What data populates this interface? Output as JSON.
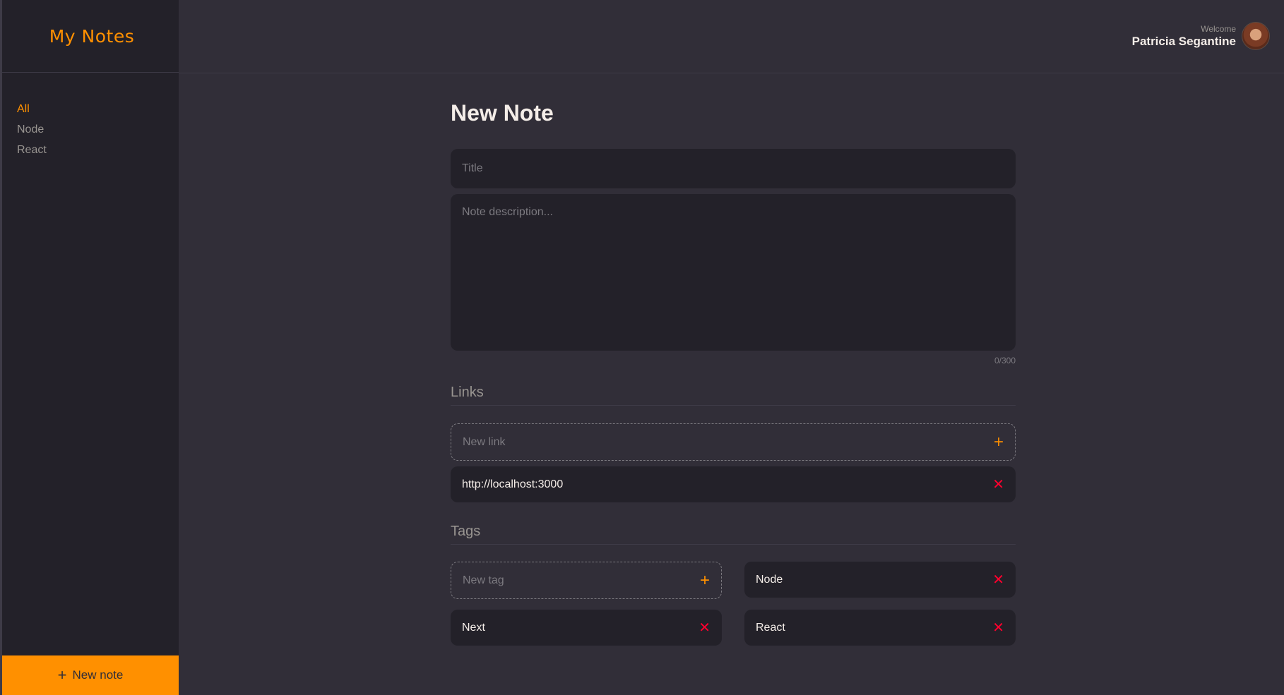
{
  "sidebar": {
    "brand": "My Notes",
    "menu": [
      {
        "label": "All",
        "active": true
      },
      {
        "label": "Node",
        "active": false
      },
      {
        "label": "React",
        "active": false
      }
    ],
    "new_note_label": "New note",
    "new_note_icon": "plus-icon"
  },
  "header": {
    "welcome": "Welcome",
    "username": "Patricia Segantine"
  },
  "main": {
    "title": "New Note",
    "title_placeholder": "Title",
    "description_placeholder": "Note description...",
    "char_counter": "0/300",
    "links": {
      "section_title": "Links",
      "new_placeholder": "New link",
      "items": [
        "http://localhost:3000"
      ]
    },
    "tags": {
      "section_title": "Tags",
      "new_placeholder": "New tag",
      "items": [
        "Node",
        "Next",
        "React"
      ]
    }
  },
  "colors": {
    "background": "#312E38",
    "sidebar": "#232129",
    "accent": "#FF9000",
    "danger": "#FF002E",
    "text": "#F4EDE8",
    "muted": "#999591"
  }
}
